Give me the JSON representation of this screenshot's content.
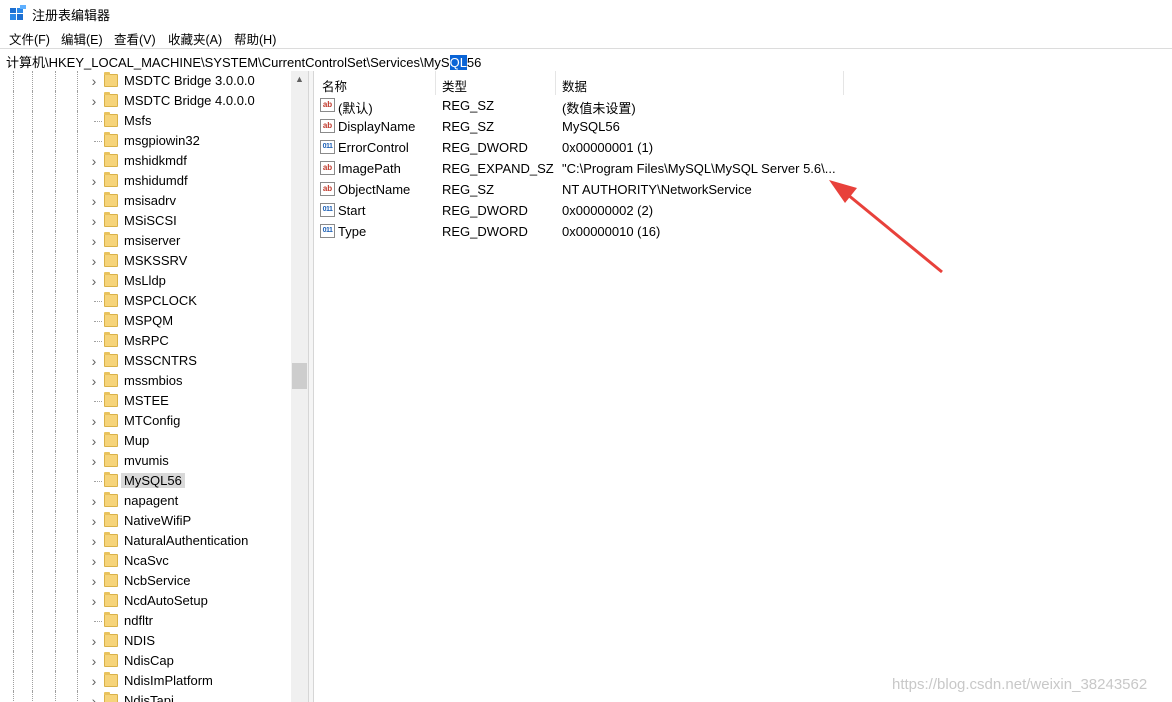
{
  "window": {
    "title": "注册表编辑器"
  },
  "menu": [
    "文件(F)",
    "编辑(E)",
    "查看(V)",
    "收藏夹(A)",
    "帮助(H)"
  ],
  "address": {
    "before_selection": "计算机\\HKEY_LOCAL_MACHINE\\SYSTEM\\CurrentControlSet\\Services\\MyS",
    "selection": "QL",
    "after_selection": "56"
  },
  "tree": {
    "items": [
      {
        "label": "MSDTC Bridge 3.0.0.0",
        "expandable": true
      },
      {
        "label": "MSDTC Bridge 4.0.0.0",
        "expandable": true
      },
      {
        "label": "Msfs",
        "expandable": false
      },
      {
        "label": "msgpiowin32",
        "expandable": false
      },
      {
        "label": "mshidkmdf",
        "expandable": true
      },
      {
        "label": "mshidumdf",
        "expandable": true
      },
      {
        "label": "msisadrv",
        "expandable": true
      },
      {
        "label": "MSiSCSI",
        "expandable": true
      },
      {
        "label": "msiserver",
        "expandable": true
      },
      {
        "label": "MSKSSRV",
        "expandable": true
      },
      {
        "label": "MsLldp",
        "expandable": true
      },
      {
        "label": "MSPCLOCK",
        "expandable": false
      },
      {
        "label": "MSPQM",
        "expandable": false
      },
      {
        "label": "MsRPC",
        "expandable": false
      },
      {
        "label": "MSSCNTRS",
        "expandable": true
      },
      {
        "label": "mssmbios",
        "expandable": true
      },
      {
        "label": "MSTEE",
        "expandable": false
      },
      {
        "label": "MTConfig",
        "expandable": true
      },
      {
        "label": "Mup",
        "expandable": true
      },
      {
        "label": "mvumis",
        "expandable": true
      },
      {
        "label": "MySQL56",
        "expandable": false,
        "selected": true
      },
      {
        "label": "napagent",
        "expandable": true
      },
      {
        "label": "NativeWifiP",
        "expandable": true
      },
      {
        "label": "NaturalAuthentication",
        "expandable": true
      },
      {
        "label": "NcaSvc",
        "expandable": true
      },
      {
        "label": "NcbService",
        "expandable": true
      },
      {
        "label": "NcdAutoSetup",
        "expandable": true
      },
      {
        "label": "ndfltr",
        "expandable": false
      },
      {
        "label": "NDIS",
        "expandable": true
      },
      {
        "label": "NdisCap",
        "expandable": true
      },
      {
        "label": "NdisImPlatform",
        "expandable": true
      },
      {
        "label": "NdisTapi",
        "expandable": true
      }
    ]
  },
  "list": {
    "columns": [
      "名称",
      "类型",
      "数据"
    ],
    "rows": [
      {
        "icon": "string-value-icon",
        "name": "(默认)",
        "type": "REG_SZ",
        "data": "(数值未设置)"
      },
      {
        "icon": "string-value-icon",
        "name": "DisplayName",
        "type": "REG_SZ",
        "data": "MySQL56"
      },
      {
        "icon": "binary-value-icon",
        "name": "ErrorControl",
        "type": "REG_DWORD",
        "data": "0x00000001 (1)"
      },
      {
        "icon": "string-value-icon",
        "name": "ImagePath",
        "type": "REG_EXPAND_SZ",
        "data": "\"C:\\Program Files\\MySQL\\MySQL Server 5.6\\..."
      },
      {
        "icon": "string-value-icon",
        "name": "ObjectName",
        "type": "REG_SZ",
        "data": "NT AUTHORITY\\NetworkService"
      },
      {
        "icon": "binary-value-icon",
        "name": "Start",
        "type": "REG_DWORD",
        "data": "0x00000002 (2)"
      },
      {
        "icon": "binary-value-icon",
        "name": "Type",
        "type": "REG_DWORD",
        "data": "0x00000010 (16)"
      }
    ]
  },
  "watermark": "https://blog.csdn.net/weixin_38243562",
  "colors": {
    "selection": "#0a64d6",
    "folder": "#f6d47a",
    "annotation_arrow": "#e8413b"
  }
}
